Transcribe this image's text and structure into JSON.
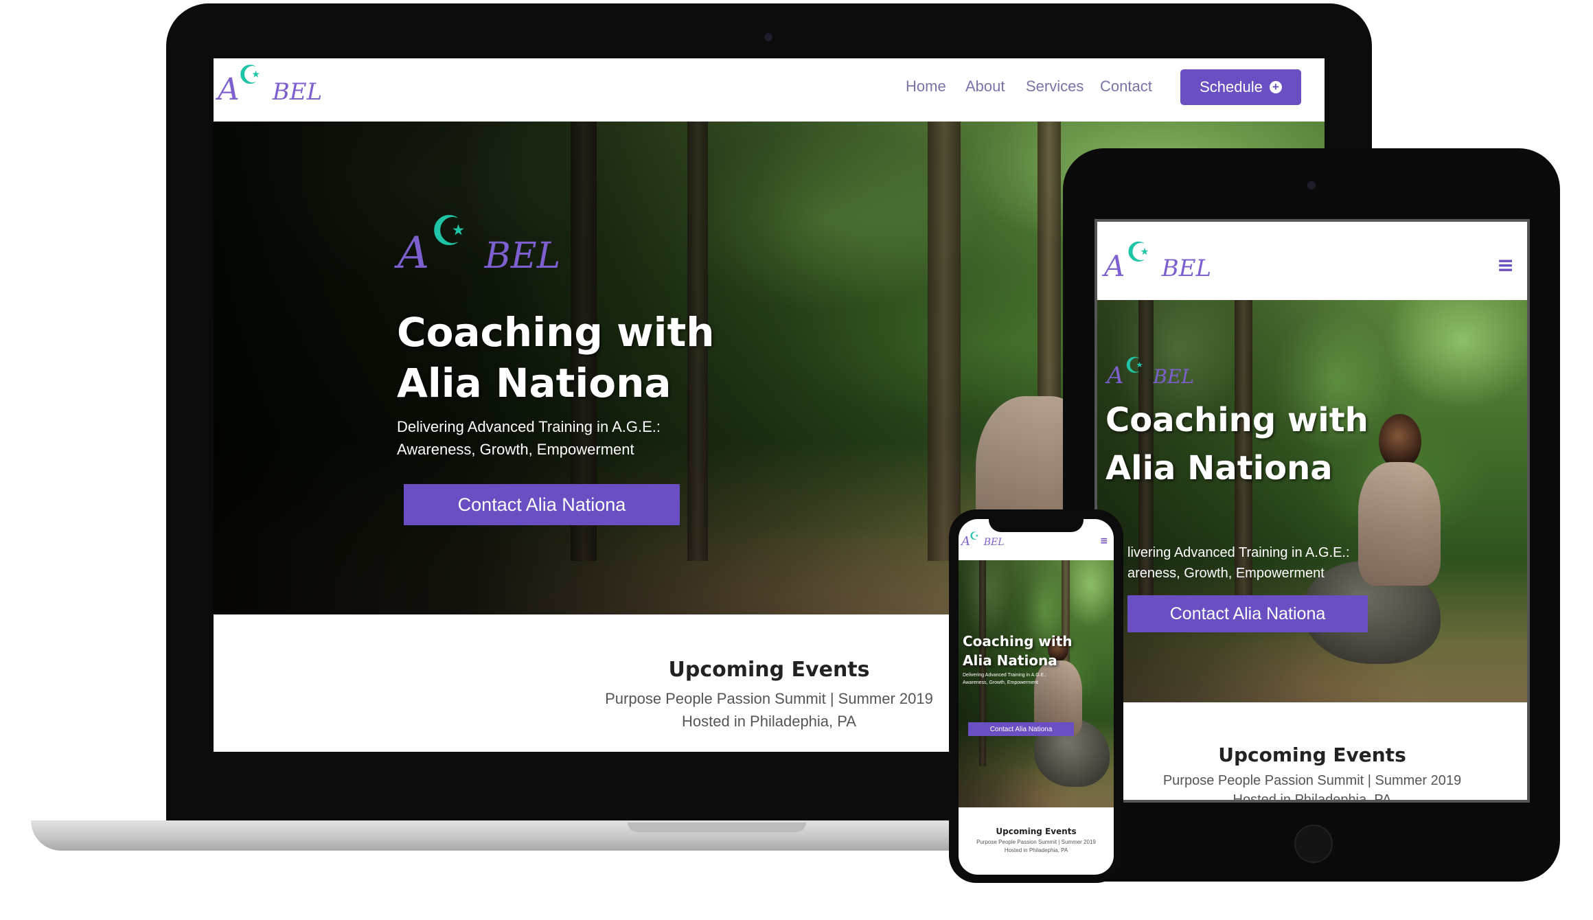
{
  "brand": {
    "logo_a": "A",
    "logo_bel": "BEL",
    "purple": "#6a4fc2",
    "teal": "#1fc4a6"
  },
  "nav": {
    "links": [
      "Home",
      "About",
      "Services",
      "Contact"
    ],
    "schedule_label": "Schedule"
  },
  "hero": {
    "title_line1": "Coaching with",
    "title_line2": "Alia Nationa",
    "subtitle_line1": "Delivering Advanced Training in A.G.E.:",
    "subtitle_line2": "Awareness, Growth, Empowerment",
    "button_label": "Contact Alia Nationa"
  },
  "tablet_hero": {
    "subtitle_line1": "livering Advanced Training in A.G.E.:",
    "subtitle_line2": "areness, Growth, Empowerment"
  },
  "events": {
    "title": "Upcoming Events",
    "line1": "Purpose People Passion Summit | Summer 2019",
    "line2": "Hosted in Philadephia, PA"
  },
  "icons": {
    "menu": "hamburger-icon",
    "schedule": "plus-circle-icon",
    "logo_star": "crescent-star-icon"
  }
}
